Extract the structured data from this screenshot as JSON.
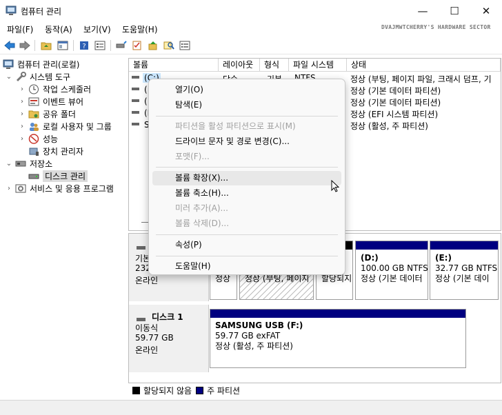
{
  "window": {
    "title": "컴퓨터 관리",
    "minimize": "—",
    "maximize": "☐",
    "close": "✕"
  },
  "menu": {
    "items": [
      "파일(F)",
      "동작(A)",
      "보기(V)",
      "도움말(H)"
    ]
  },
  "watermark": "DVAJMWTCHERRY'S HARDWARE SECTOR",
  "toolbar": {
    "icons": [
      "back-arrow-icon",
      "forward-arrow-icon",
      "up-folder-icon",
      "show-hide-tree-icon",
      "help-icon",
      "properties-icon",
      "disk-connect-icon",
      "checklist-icon",
      "export-icon",
      "search-disk-icon",
      "list-view-icon"
    ]
  },
  "tree": {
    "root": "컴퓨터 관리(로컬)",
    "system_tools": "시스템 도구",
    "task_scheduler": "작업 스케줄러",
    "event_viewer": "이벤트 뷰어",
    "shared_folders": "공유 폴더",
    "local_users": "로컬 사용자 및 그룹",
    "performance": "성능",
    "device_manager": "장치 관리자",
    "storage": "저장소",
    "disk_management": "디스크 관리",
    "services": "서비스 및 응용 프로그램"
  },
  "volume_list": {
    "headers": {
      "volume": "볼륨",
      "layout": "레이아웃",
      "type": "형식",
      "filesystem": "파일 시스템",
      "status": "상태"
    },
    "rows": [
      {
        "volume": "(C:)",
        "layout": "단순",
        "type": "기본",
        "filesystem": "NTFS",
        "status": "정상 (부팅, 페이지 파일, 크래시 덤프, 기"
      },
      {
        "volume": "(",
        "layout": "",
        "type": "",
        "filesystem": "",
        "status": "정상 (기본 데이터 파티션)"
      },
      {
        "volume": "(",
        "layout": "",
        "type": "",
        "filesystem": "",
        "status": "정상 (기본 데이터 파티션)"
      },
      {
        "volume": "(D",
        "layout": "",
        "type": "",
        "filesystem": "",
        "status": "정상 (EFI 시스템 파티션)"
      },
      {
        "volume": "S",
        "layout": "",
        "type": "",
        "filesystem": "",
        "status": "정상 (활성, 주 파티션)"
      }
    ]
  },
  "disk0": {
    "label_type": "기본",
    "label_size": "232",
    "label_status": "온라인",
    "part_a_status": "정상",
    "part_b_status": "정상 (부팅, 페이지",
    "part_c_status": "할당되지",
    "part_d_name": "(D:)",
    "part_d_size": "100.00 GB NTFS",
    "part_d_status": "정상 (기본 데이터",
    "part_e_name": "(E:)",
    "part_e_size": "32.77 GB NTFS",
    "part_e_status": "정상 (기본 데이"
  },
  "disk1": {
    "name": "디스크 1",
    "type": "이동식",
    "size": "59.77 GB",
    "status": "온라인",
    "part_name": "SAMSUNG USB  (F:)",
    "part_size": "59.77 GB exFAT",
    "part_status": "정상 (활성, 주 파티션)"
  },
  "legend": {
    "unallocated": "할당되지 않음",
    "primary": "주 파티션"
  },
  "context_menu": {
    "open": "열기(O)",
    "explore": "탐색(E)",
    "mark_active": "파티션을 활성 파티션으로 표시(M)",
    "change_letter": "드라이브 문자 및 경로 변경(C)...",
    "format": "포맷(F)...",
    "extend": "볼륨 확장(X)...",
    "shrink": "볼륨 축소(H)...",
    "add_mirror": "미러 추가(A)...",
    "delete": "볼륨 삭제(D)...",
    "properties": "속성(P)",
    "help": "도움말(H)"
  },
  "colors": {
    "primary_partition": "#000080",
    "unallocated": "#000000",
    "selection": "#cce8ff"
  }
}
